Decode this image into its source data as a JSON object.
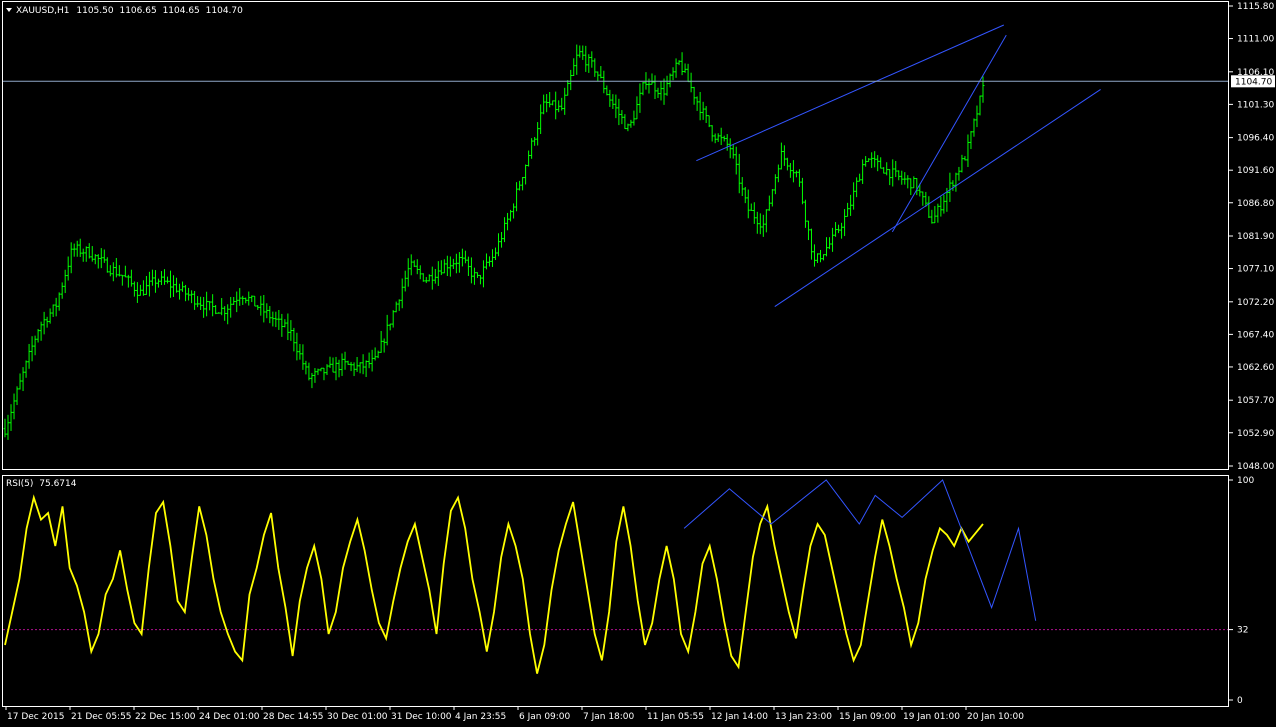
{
  "header": {
    "symbol": "XAUUSD,H1",
    "open": "1105.50",
    "high": "1106.65",
    "low": "1104.65",
    "close": "1104.70"
  },
  "rsi_header": {
    "name": "RSI(5)",
    "value": "75.6714"
  },
  "colors": {
    "background": "#000000",
    "candle": "#00ff00",
    "rsi_line": "#ffff00",
    "trendline": "#3355ff",
    "price_line": "#8fa7c8",
    "level_line": "#b0108f",
    "axis": "#ffffff"
  },
  "chart_data": [
    {
      "type": "bar",
      "name": "price",
      "y_ticks": [
        "1115.80",
        "1111.00",
        "1106.10",
        "1101.30",
        "1096.40",
        "1091.60",
        "1086.80",
        "1081.90",
        "1077.10",
        "1072.20",
        "1067.40",
        "1062.60",
        "1057.70",
        "1052.90",
        "1048.00"
      ],
      "ylim": [
        1048.0,
        1115.8
      ],
      "current_price": "1104.70",
      "x_ticks": [
        "17 Dec 2015",
        "21 Dec 05:55",
        "22 Dec 15:00",
        "24 Dec 01:00",
        "28 Dec 14:55",
        "30 Dec 01:00",
        "31 Dec 10:00",
        "4 Jan 23:55",
        "6 Jan 09:00",
        "7 Jan 18:00",
        "11 Jan 05:55",
        "12 Jan 14:00",
        "13 Jan 23:00",
        "15 Jan 09:00",
        "19 Jan 01:00",
        "20 Jan 10:00"
      ],
      "path_y": [
        1053.5,
        1061.0,
        1068.5,
        1071.5,
        1080.0,
        1079.5,
        1077.5,
        1076.0,
        1073.5,
        1075.5,
        1074.5,
        1073.0,
        1071.5,
        1071.0,
        1073.5,
        1071.5,
        1069.5,
        1067.5,
        1061.0,
        1062.0,
        1063.0,
        1062.5,
        1063.5,
        1070.5,
        1077.5,
        1075.5,
        1077.5,
        1078.5,
        1075.5,
        1079.0,
        1085.5,
        1093.5,
        1101.5,
        1100.5,
        1109.0,
        1106.5,
        1101.5,
        1097.5,
        1105.0,
        1103.0,
        1107.5,
        1102.0,
        1097.0,
        1095.0,
        1086.0,
        1083.5,
        1094.0,
        1091.0,
        1078.0,
        1081.0,
        1085.5,
        1093.5,
        1092.0,
        1090.5,
        1089.5,
        1084.0,
        1089.0,
        1094.0,
        1103.5
      ]
    },
    {
      "type": "line",
      "name": "RSI(5)",
      "ylim": [
        0,
        100
      ],
      "y_ticks": [
        "100",
        "32",
        "0"
      ],
      "level": 32,
      "last_value": 75.6714,
      "values": [
        25,
        40,
        55,
        78,
        92,
        82,
        85,
        70,
        88,
        60,
        52,
        40,
        22,
        30,
        48,
        55,
        68,
        50,
        35,
        30,
        60,
        85,
        90,
        70,
        45,
        40,
        65,
        88,
        75,
        55,
        40,
        30,
        22,
        18,
        48,
        60,
        75,
        85,
        60,
        42,
        20,
        45,
        60,
        70,
        55,
        30,
        40,
        60,
        72,
        82,
        68,
        50,
        35,
        28,
        45,
        60,
        72,
        80,
        65,
        50,
        30,
        62,
        86,
        92,
        78,
        55,
        40,
        22,
        40,
        65,
        80,
        70,
        55,
        30,
        12,
        25,
        50,
        68,
        80,
        90,
        70,
        50,
        30,
        18,
        40,
        72,
        88,
        70,
        45,
        25,
        35,
        55,
        70,
        55,
        30,
        22,
        40,
        62,
        70,
        55,
        36,
        20,
        15,
        40,
        65,
        80,
        88,
        70,
        55,
        40,
        28,
        50,
        70,
        80,
        75,
        60,
        45,
        30,
        18,
        25,
        45,
        65,
        82,
        70,
        55,
        42,
        25,
        35,
        55,
        68,
        78,
        75,
        70,
        78,
        72,
        76,
        80
      ]
    },
    {
      "type": "line",
      "name": "trendlines",
      "lines": [
        {
          "x": [
            0.566,
            0.817
          ],
          "y": [
            1093.0,
            1113.0
          ]
        },
        {
          "x": [
            0.63,
            0.896
          ],
          "y": [
            1071.5,
            1103.5
          ]
        },
        {
          "x": [
            0.726,
            0.819
          ],
          "y": [
            1082.5,
            1111.5
          ]
        }
      ]
    },
    {
      "type": "line",
      "name": "rsi-trendline",
      "x": [
        0.556,
        0.593,
        0.627,
        0.672,
        0.699,
        0.712,
        0.734,
        0.767,
        0.807,
        0.829,
        0.843
      ],
      "y": [
        78,
        96,
        80,
        100,
        80,
        93,
        83,
        100,
        42,
        78,
        36
      ]
    }
  ]
}
